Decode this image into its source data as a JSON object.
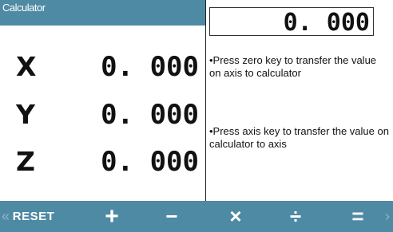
{
  "title": "Calculator",
  "axes": [
    {
      "label": "X",
      "value": "0. 000"
    },
    {
      "label": "Y",
      "value": "0. 000"
    },
    {
      "label": "Z",
      "value": "0. 000"
    }
  ],
  "calculator": {
    "display": "0. 000"
  },
  "hints": [
    "•Press zero key to transfer the value on axis to calculator",
    "•Press axis key to transfer the value on calculator to axis"
  ],
  "softkeys": {
    "prev_arrow": "«",
    "reset": "RESET",
    "plus": "+",
    "minus": "−",
    "multiply": "×",
    "divide": "÷",
    "equals": "=",
    "next_arrow": "›"
  },
  "colors": {
    "accent": "#4e8aa3"
  }
}
